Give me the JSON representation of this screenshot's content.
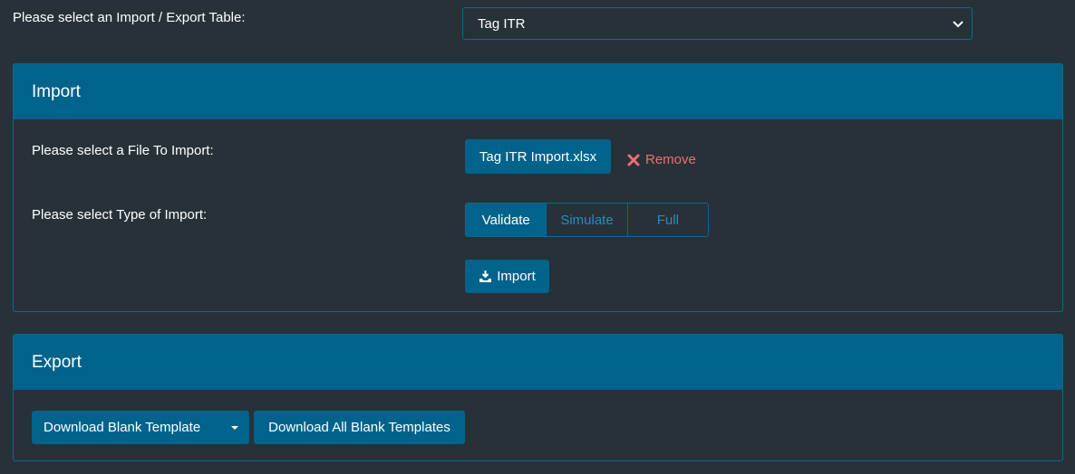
{
  "table_select": {
    "label": "Please select an Import / Export Table:",
    "selected": "Tag ITR"
  },
  "import_panel": {
    "title": "Import",
    "file_label": "Please select a File To Import:",
    "file_button": "Tag ITR Import.xlsx",
    "remove_label": "Remove",
    "type_label": "Please select Type of Import:",
    "types": [
      {
        "label": "Validate",
        "active": true
      },
      {
        "label": "Simulate",
        "active": false
      },
      {
        "label": "Full",
        "active": false
      }
    ],
    "import_button": "Import"
  },
  "export_panel": {
    "title": "Export",
    "download_blank": "Download Blank Template",
    "download_all": "Download All Blank Templates"
  },
  "colors": {
    "background": "#263238",
    "accent": "#00638b",
    "border": "#0a6a90",
    "remove": "#ef6d73",
    "inactive_option": "#2a8bbd"
  },
  "icons": {
    "select": "chevron-down-icon",
    "remove": "close-icon",
    "import": "import-icon",
    "split": "caret-down-icon"
  }
}
